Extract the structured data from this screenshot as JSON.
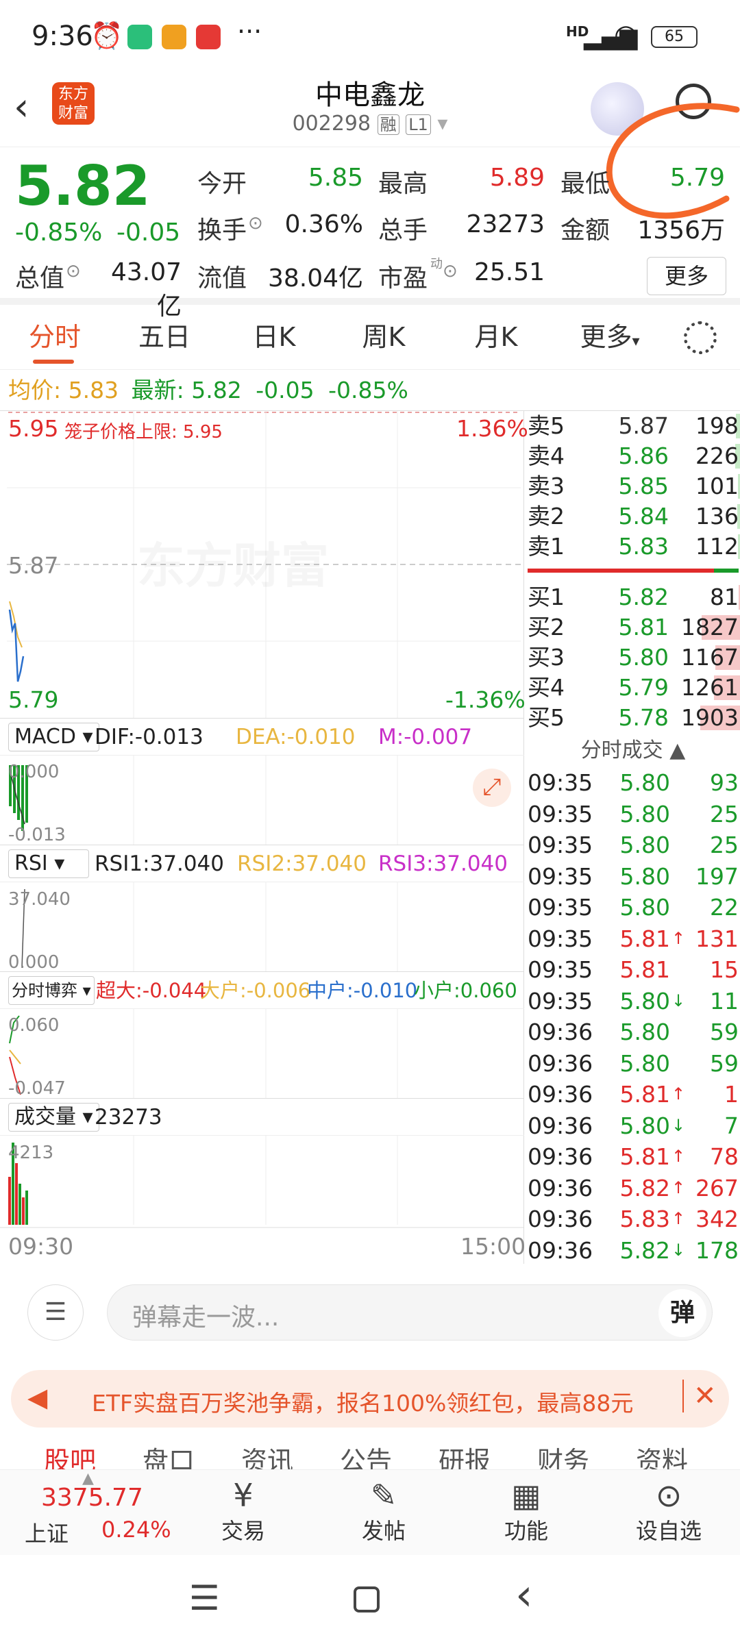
{
  "status": {
    "time": "9:36",
    "battery": "65",
    "net": "HD"
  },
  "header": {
    "logo": "东方\n财富",
    "title": "中电鑫龙",
    "code": "002298",
    "tag1": "融",
    "tag2": "L1"
  },
  "quote": {
    "price": "5.82",
    "pct": "-0.85%",
    "chg": "-0.05",
    "l_open": "今开",
    "v_open": "5.85",
    "l_high": "最高",
    "v_high": "5.89",
    "l_low": "最低",
    "v_low": "5.79",
    "l_turn": "换手",
    "v_turn": "0.36%",
    "l_vol": "总手",
    "v_vol": "23273",
    "l_amt": "金额",
    "v_amt": "1356万",
    "l_mcap": "总值",
    "v_mcap": "43.07亿",
    "l_float": "流值",
    "v_float": "38.04亿",
    "l_pe": "市盈",
    "pe_sup": "动",
    "v_pe": "25.51",
    "more": "更多"
  },
  "tabs": [
    "分时",
    "五日",
    "日K",
    "周K",
    "月K",
    "更多"
  ],
  "avg": {
    "l_avg": "均价:",
    "v_avg": "5.83",
    "l_last": "最新:",
    "v_last": "5.82",
    "chg": "-0.05",
    "pct": "-0.85%"
  },
  "chart": {
    "top": "5.95",
    "limit": "笼子价格上限: 5.95",
    "toppct": "1.36%",
    "mid": "5.87",
    "bottom": "5.79",
    "botpct": "-1.36%",
    "watermark": "东方财富",
    "t_start": "09:30",
    "t_end": "15:00"
  },
  "macd": {
    "sel": "MACD",
    "dif": "DIF:-0.013",
    "dea": "DEA:-0.010",
    "m": "M:-0.007",
    "top": "0.000",
    "bot": "-0.013"
  },
  "rsi": {
    "sel": "RSI",
    "r1": "RSI1:37.040",
    "r2": "RSI2:37.040",
    "r3": "RSI3:37.040",
    "top": "37.040",
    "bot": "0.000"
  },
  "game": {
    "sel": "分时博弈",
    "a": "超大:-0.044",
    "b": "大户:-0.006",
    "c": "中户:-0.010",
    "d": "小户:0.060",
    "top": "0.060",
    "bot": "-0.047"
  },
  "vol": {
    "sel": "成交量",
    "v": "23273",
    "top": "4213"
  },
  "sells": [
    {
      "l": "卖5",
      "p": "5.87",
      "v": "198"
    },
    {
      "l": "卖4",
      "p": "5.86",
      "v": "226"
    },
    {
      "l": "卖3",
      "p": "5.85",
      "v": "101"
    },
    {
      "l": "卖2",
      "p": "5.84",
      "v": "136"
    },
    {
      "l": "卖1",
      "p": "5.83",
      "v": "112"
    }
  ],
  "buys": [
    {
      "l": "买1",
      "p": "5.82",
      "v": "81"
    },
    {
      "l": "买2",
      "p": "5.81",
      "v": "1827"
    },
    {
      "l": "买3",
      "p": "5.80",
      "v": "1167"
    },
    {
      "l": "买4",
      "p": "5.79",
      "v": "1261"
    },
    {
      "l": "买5",
      "p": "5.78",
      "v": "1903"
    }
  ],
  "tick_title": "分时成交",
  "ticks": [
    {
      "t": "09:35",
      "p": "5.80",
      "a": "",
      "v": "93",
      "c": "g"
    },
    {
      "t": "09:35",
      "p": "5.80",
      "a": "",
      "v": "25",
      "c": "g"
    },
    {
      "t": "09:35",
      "p": "5.80",
      "a": "",
      "v": "25",
      "c": "g"
    },
    {
      "t": "09:35",
      "p": "5.80",
      "a": "",
      "v": "197",
      "c": "g"
    },
    {
      "t": "09:35",
      "p": "5.80",
      "a": "",
      "v": "22",
      "c": "g"
    },
    {
      "t": "09:35",
      "p": "5.81",
      "a": "↑",
      "v": "131",
      "c": "r"
    },
    {
      "t": "09:35",
      "p": "5.81",
      "a": "",
      "v": "15",
      "c": "r"
    },
    {
      "t": "09:35",
      "p": "5.80",
      "a": "↓",
      "v": "11",
      "c": "g"
    },
    {
      "t": "09:36",
      "p": "5.80",
      "a": "",
      "v": "59",
      "c": "g"
    },
    {
      "t": "09:36",
      "p": "5.80",
      "a": "",
      "v": "59",
      "c": "g"
    },
    {
      "t": "09:36",
      "p": "5.81",
      "a": "↑",
      "v": "1",
      "c": "r"
    },
    {
      "t": "09:36",
      "p": "5.80",
      "a": "↓",
      "v": "7",
      "c": "g"
    },
    {
      "t": "09:36",
      "p": "5.81",
      "a": "↑",
      "v": "78",
      "c": "r"
    },
    {
      "t": "09:36",
      "p": "5.82",
      "a": "↑",
      "v": "267",
      "c": "r"
    },
    {
      "t": "09:36",
      "p": "5.83",
      "a": "↑",
      "v": "342",
      "c": "r"
    },
    {
      "t": "09:36",
      "p": "5.82",
      "a": "↓",
      "v": "178",
      "c": "g"
    }
  ],
  "danmu": {
    "placeholder": "弹幕走一波...",
    "btn": "弹"
  },
  "banner": "ETF实盘百万奖池争霸，报名100%领红包，最高88元",
  "subtabs": [
    "股吧",
    "盘口",
    "资讯",
    "公告",
    "研报",
    "财务",
    "资料"
  ],
  "bottom": {
    "index_val": "3375.77",
    "index_name": "上证",
    "index_pct": "0.24%",
    "items": [
      "交易",
      "发帖",
      "功能",
      "设自选"
    ]
  },
  "colors": {
    "up": "#e02b2b",
    "down": "#1a9a2a",
    "accent": "#e5542b"
  }
}
